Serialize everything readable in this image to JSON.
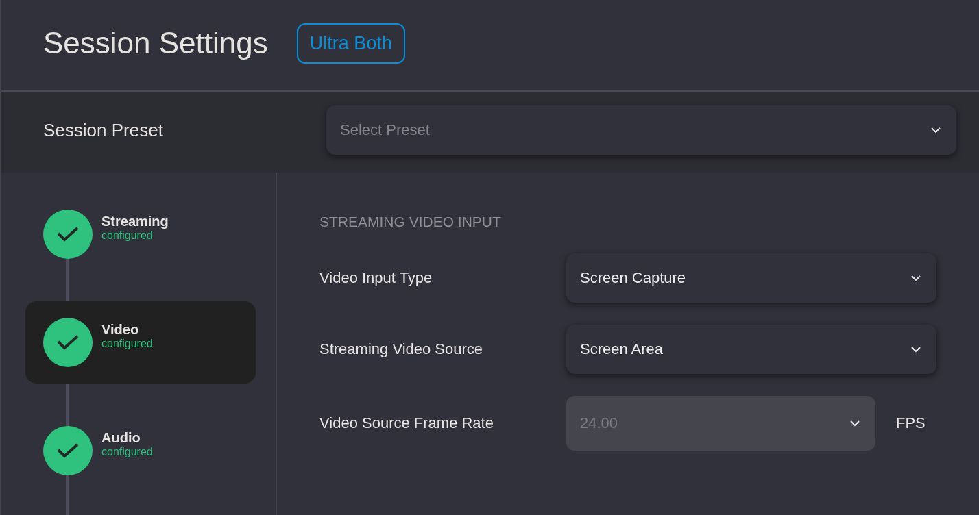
{
  "header": {
    "title": "Session Settings",
    "badge": "Ultra Both"
  },
  "preset": {
    "label": "Session Preset",
    "placeholder": "Select Preset"
  },
  "steps": [
    {
      "label": "Streaming",
      "status": "configured",
      "done": true,
      "selected": false
    },
    {
      "label": "Video",
      "status": "configured",
      "done": true,
      "selected": true
    },
    {
      "label": "Audio",
      "status": "configured",
      "done": true,
      "selected": false
    }
  ],
  "section": {
    "title": "STREAMING VIDEO INPUT",
    "fields": [
      {
        "label": "Video Input Type",
        "value": "Screen Capture",
        "disabled": false
      },
      {
        "label": "Streaming Video Source",
        "value": "Screen Area",
        "disabled": false
      },
      {
        "label": "Video Source Frame Rate",
        "value": "24.00",
        "disabled": true,
        "unit": "FPS"
      }
    ]
  }
}
